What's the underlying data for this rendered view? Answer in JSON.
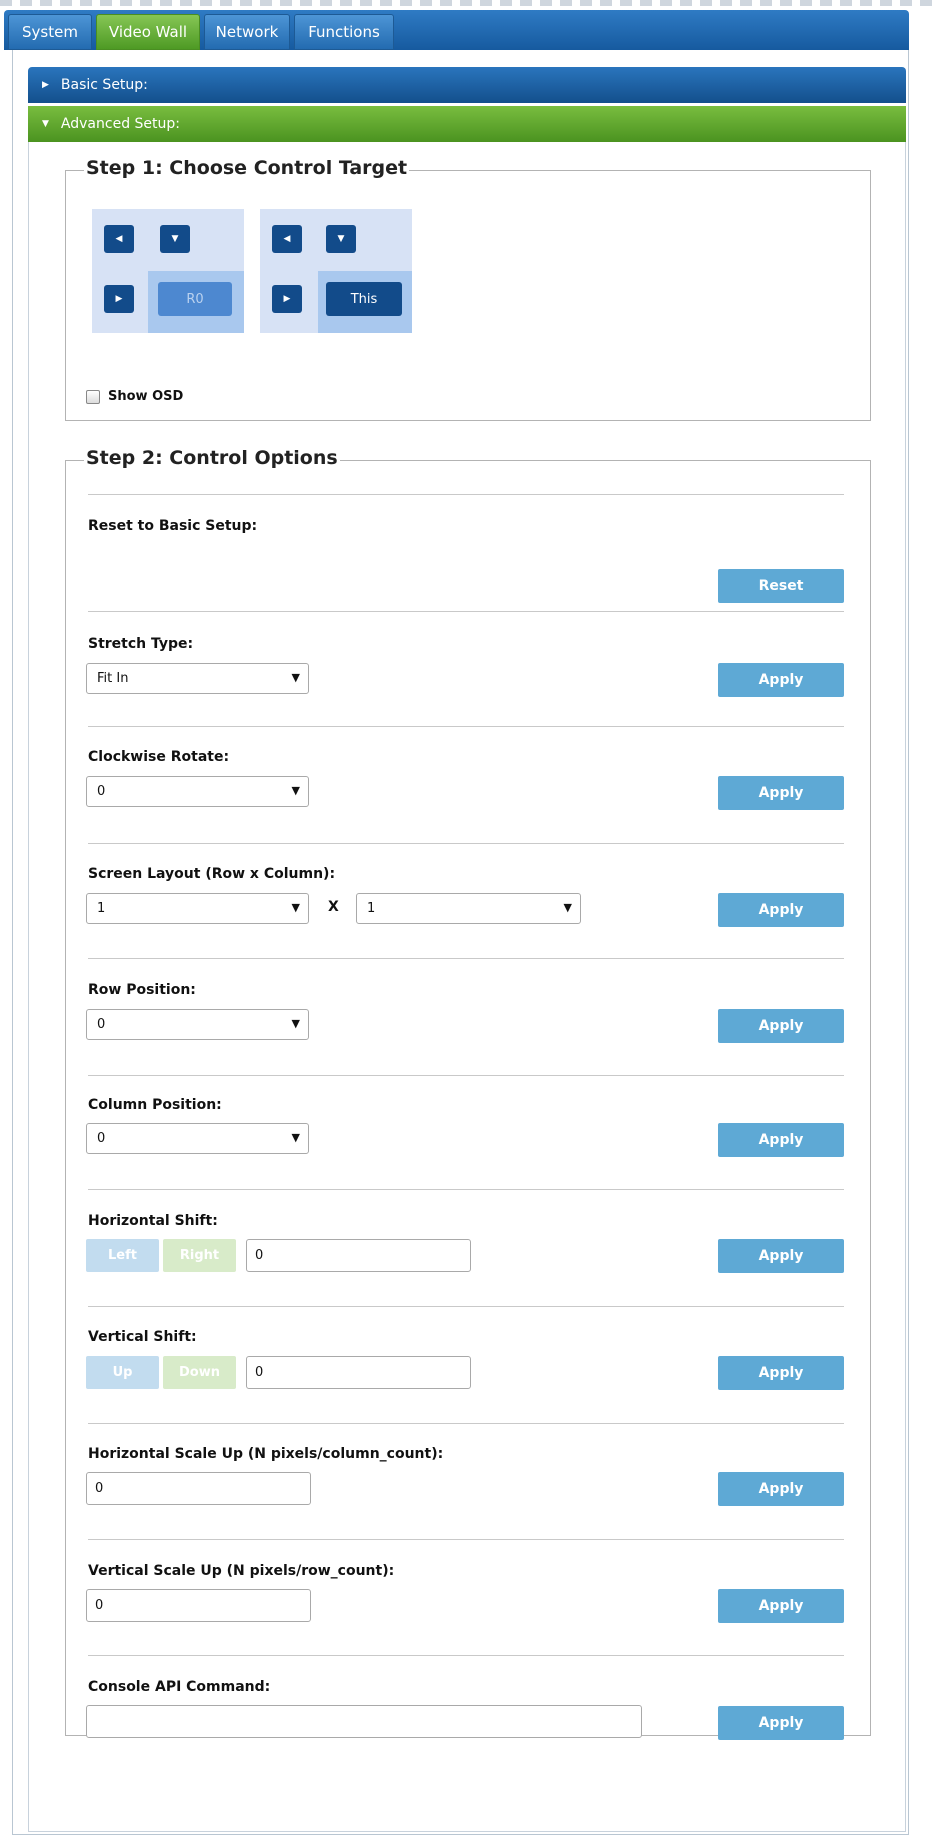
{
  "tabs": [
    "System",
    "Video Wall",
    "Network",
    "Functions"
  ],
  "accordion": {
    "basic": "Basic Setup:",
    "advanced": "Advanced Setup:"
  },
  "step1": {
    "title": "Step 1: Choose Control Target",
    "targets": [
      "R0",
      "This"
    ],
    "show_osd": "Show OSD"
  },
  "step2": {
    "title": "Step 2: Control Options",
    "reset_label": "Reset to Basic Setup:",
    "reset_button": "Reset",
    "apply_button": "Apply",
    "stretch": {
      "label": "Stretch Type:",
      "value": "Fit In"
    },
    "rotate": {
      "label": "Clockwise Rotate:",
      "value": "0"
    },
    "layout": {
      "label": "Screen Layout (Row x Column):",
      "rows": "1",
      "cols": "1",
      "x": "X"
    },
    "row_position": {
      "label": "Row Position:",
      "value": "0"
    },
    "column_position": {
      "label": "Column Position:",
      "value": "0"
    },
    "hshift": {
      "label": "Horizontal Shift:",
      "left": "Left",
      "right": "Right",
      "value": "0"
    },
    "vshift": {
      "label": "Vertical Shift:",
      "up": "Up",
      "down": "Down",
      "value": "0"
    },
    "hscale": {
      "label": "Horizontal Scale Up (N pixels/column_count):",
      "value": "0"
    },
    "vscale": {
      "label": "Vertical Scale Up (N pixels/row_count):",
      "value": "0"
    },
    "console": {
      "label": "Console API Command:",
      "value": ""
    }
  },
  "colors": {
    "tab_blue": "#236bb0",
    "tab_green": "#4e9a24",
    "apply_button": "#5ea9d5",
    "nav_button": "#124b8a"
  }
}
